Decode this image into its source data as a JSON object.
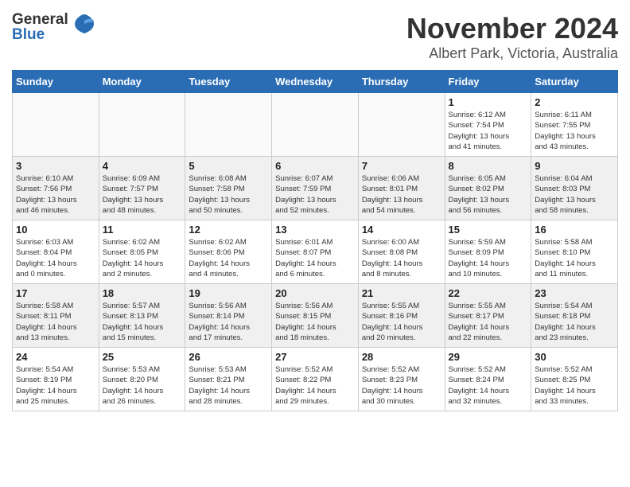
{
  "header": {
    "logo_general": "General",
    "logo_blue": "Blue",
    "title": "November 2024",
    "subtitle": "Albert Park, Victoria, Australia"
  },
  "weekdays": [
    "Sunday",
    "Monday",
    "Tuesday",
    "Wednesday",
    "Thursday",
    "Friday",
    "Saturday"
  ],
  "weeks": [
    {
      "days": [
        {
          "num": "",
          "detail": ""
        },
        {
          "num": "",
          "detail": ""
        },
        {
          "num": "",
          "detail": ""
        },
        {
          "num": "",
          "detail": ""
        },
        {
          "num": "",
          "detail": ""
        },
        {
          "num": "1",
          "detail": "Sunrise: 6:12 AM\nSunset: 7:54 PM\nDaylight: 13 hours\nand 41 minutes."
        },
        {
          "num": "2",
          "detail": "Sunrise: 6:11 AM\nSunset: 7:55 PM\nDaylight: 13 hours\nand 43 minutes."
        }
      ]
    },
    {
      "days": [
        {
          "num": "3",
          "detail": "Sunrise: 6:10 AM\nSunset: 7:56 PM\nDaylight: 13 hours\nand 46 minutes."
        },
        {
          "num": "4",
          "detail": "Sunrise: 6:09 AM\nSunset: 7:57 PM\nDaylight: 13 hours\nand 48 minutes."
        },
        {
          "num": "5",
          "detail": "Sunrise: 6:08 AM\nSunset: 7:58 PM\nDaylight: 13 hours\nand 50 minutes."
        },
        {
          "num": "6",
          "detail": "Sunrise: 6:07 AM\nSunset: 7:59 PM\nDaylight: 13 hours\nand 52 minutes."
        },
        {
          "num": "7",
          "detail": "Sunrise: 6:06 AM\nSunset: 8:01 PM\nDaylight: 13 hours\nand 54 minutes."
        },
        {
          "num": "8",
          "detail": "Sunrise: 6:05 AM\nSunset: 8:02 PM\nDaylight: 13 hours\nand 56 minutes."
        },
        {
          "num": "9",
          "detail": "Sunrise: 6:04 AM\nSunset: 8:03 PM\nDaylight: 13 hours\nand 58 minutes."
        }
      ]
    },
    {
      "days": [
        {
          "num": "10",
          "detail": "Sunrise: 6:03 AM\nSunset: 8:04 PM\nDaylight: 14 hours\nand 0 minutes."
        },
        {
          "num": "11",
          "detail": "Sunrise: 6:02 AM\nSunset: 8:05 PM\nDaylight: 14 hours\nand 2 minutes."
        },
        {
          "num": "12",
          "detail": "Sunrise: 6:02 AM\nSunset: 8:06 PM\nDaylight: 14 hours\nand 4 minutes."
        },
        {
          "num": "13",
          "detail": "Sunrise: 6:01 AM\nSunset: 8:07 PM\nDaylight: 14 hours\nand 6 minutes."
        },
        {
          "num": "14",
          "detail": "Sunrise: 6:00 AM\nSunset: 8:08 PM\nDaylight: 14 hours\nand 8 minutes."
        },
        {
          "num": "15",
          "detail": "Sunrise: 5:59 AM\nSunset: 8:09 PM\nDaylight: 14 hours\nand 10 minutes."
        },
        {
          "num": "16",
          "detail": "Sunrise: 5:58 AM\nSunset: 8:10 PM\nDaylight: 14 hours\nand 11 minutes."
        }
      ]
    },
    {
      "days": [
        {
          "num": "17",
          "detail": "Sunrise: 5:58 AM\nSunset: 8:11 PM\nDaylight: 14 hours\nand 13 minutes."
        },
        {
          "num": "18",
          "detail": "Sunrise: 5:57 AM\nSunset: 8:13 PM\nDaylight: 14 hours\nand 15 minutes."
        },
        {
          "num": "19",
          "detail": "Sunrise: 5:56 AM\nSunset: 8:14 PM\nDaylight: 14 hours\nand 17 minutes."
        },
        {
          "num": "20",
          "detail": "Sunrise: 5:56 AM\nSunset: 8:15 PM\nDaylight: 14 hours\nand 18 minutes."
        },
        {
          "num": "21",
          "detail": "Sunrise: 5:55 AM\nSunset: 8:16 PM\nDaylight: 14 hours\nand 20 minutes."
        },
        {
          "num": "22",
          "detail": "Sunrise: 5:55 AM\nSunset: 8:17 PM\nDaylight: 14 hours\nand 22 minutes."
        },
        {
          "num": "23",
          "detail": "Sunrise: 5:54 AM\nSunset: 8:18 PM\nDaylight: 14 hours\nand 23 minutes."
        }
      ]
    },
    {
      "days": [
        {
          "num": "24",
          "detail": "Sunrise: 5:54 AM\nSunset: 8:19 PM\nDaylight: 14 hours\nand 25 minutes."
        },
        {
          "num": "25",
          "detail": "Sunrise: 5:53 AM\nSunset: 8:20 PM\nDaylight: 14 hours\nand 26 minutes."
        },
        {
          "num": "26",
          "detail": "Sunrise: 5:53 AM\nSunset: 8:21 PM\nDaylight: 14 hours\nand 28 minutes."
        },
        {
          "num": "27",
          "detail": "Sunrise: 5:52 AM\nSunset: 8:22 PM\nDaylight: 14 hours\nand 29 minutes."
        },
        {
          "num": "28",
          "detail": "Sunrise: 5:52 AM\nSunset: 8:23 PM\nDaylight: 14 hours\nand 30 minutes."
        },
        {
          "num": "29",
          "detail": "Sunrise: 5:52 AM\nSunset: 8:24 PM\nDaylight: 14 hours\nand 32 minutes."
        },
        {
          "num": "30",
          "detail": "Sunrise: 5:52 AM\nSunset: 8:25 PM\nDaylight: 14 hours\nand 33 minutes."
        }
      ]
    }
  ]
}
